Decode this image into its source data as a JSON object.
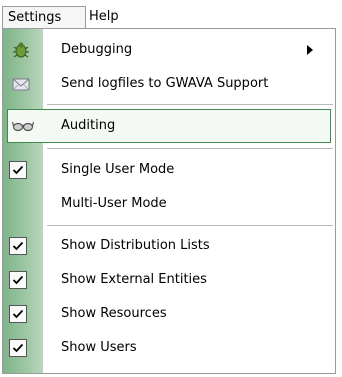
{
  "menubar": {
    "settings_label": "Settings",
    "help_label": "Help"
  },
  "menu": {
    "items": [
      {
        "label": "Debugging",
        "icon": "bug-icon",
        "has_submenu": true
      },
      {
        "label": "Send logfiles to GWAVA Support",
        "icon": "envelope-icon"
      },
      {
        "label": "Auditing",
        "icon": "glasses-icon",
        "highlighted": true
      },
      {
        "label": "Single User Mode",
        "checked": true
      },
      {
        "label": "Multi-User Mode",
        "checked": false
      },
      {
        "label": "Show Distribution Lists",
        "checked": true
      },
      {
        "label": "Show External Entities",
        "checked": true
      },
      {
        "label": "Show Resources",
        "checked": true
      },
      {
        "label": "Show Users",
        "checked": true
      }
    ]
  },
  "colors": {
    "gutter": "#9cc6a2",
    "highlight_border": "#3f8a4e"
  }
}
